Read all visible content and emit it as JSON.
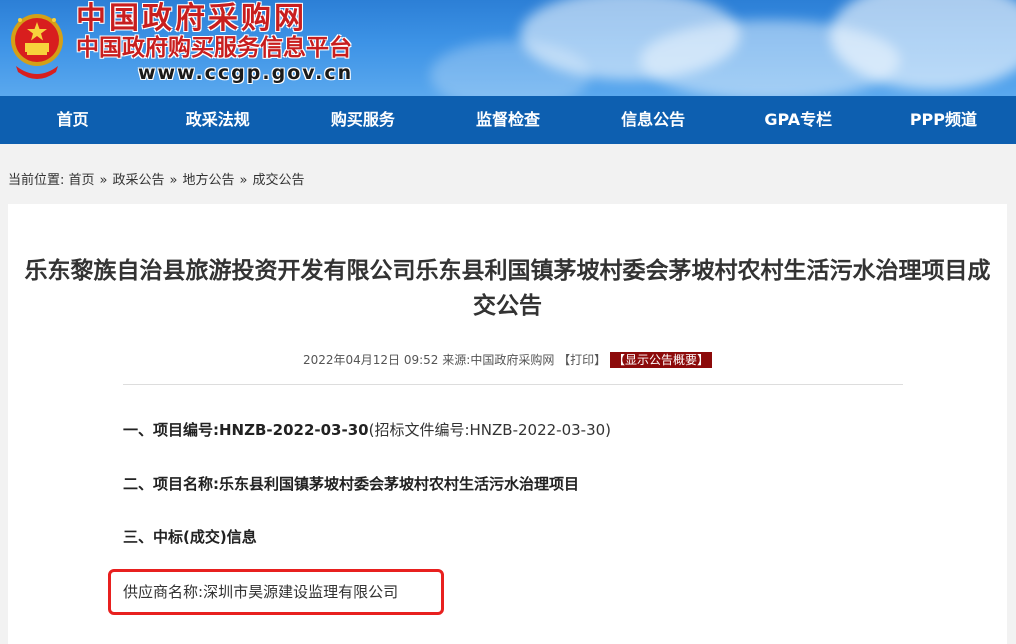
{
  "header": {
    "title": "中国政府采购网",
    "subtitle": "中国政府购买服务信息平台",
    "url": "www.ccgp.gov.cn",
    "emblem_icon": "national-emblem-icon"
  },
  "nav": {
    "items": [
      "首页",
      "政采法规",
      "购买服务",
      "监督检查",
      "信息公告",
      "GPA专栏",
      "PPP频道"
    ]
  },
  "breadcrumb": {
    "label": "当前位置:",
    "items": [
      "首页",
      "政采公告",
      "地方公告",
      "成交公告"
    ],
    "separator": "»"
  },
  "article": {
    "title": "乐东黎族自治县旅游投资开发有限公司乐东县利国镇茅坡村委会茅坡村农村生活污水治理项目成交公告",
    "date": "2022年04月12日 09:52",
    "source_label": "来源:",
    "source": "中国政府采购网",
    "print_label": "【打印】",
    "summary_label": "【显示公告概要】",
    "sections": {
      "project_no_label": "一、项目编号:",
      "project_no": "HNZB-2022-03-30",
      "tender_doc_no": "(招标文件编号:HNZB-2022-03-30)",
      "project_name_label": "二、项目名称:",
      "project_name": "乐东县利国镇茅坡村委会茅坡村农村生活污水治理项目",
      "award_heading": "三、中标(成交)信息",
      "supplier_label": "供应商名称:",
      "supplier_name": "深圳市昊源建设监理有限公司"
    }
  },
  "colors": {
    "nav_bg": "#0d5fb0",
    "title_red": "#c81e1e",
    "highlight_red": "#e8201f",
    "summary_bg": "#8c0a0a"
  }
}
